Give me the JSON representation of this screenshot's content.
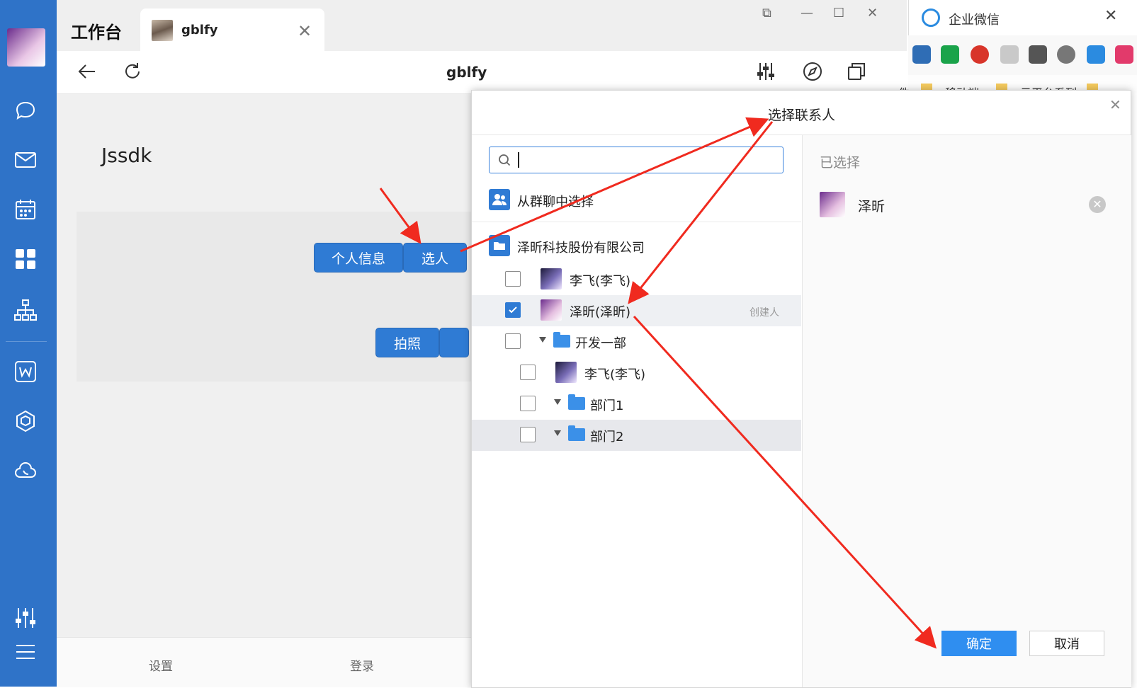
{
  "window": {
    "workbench_title": "工作台",
    "tab_label": "gblfy",
    "page_title": "gblfy"
  },
  "content": {
    "heading": "Jssdk",
    "buttons": {
      "personal_info": "个人信息",
      "select_people": "选人",
      "take_photo": "拍照"
    },
    "bottom_links": [
      "设置",
      "登录"
    ]
  },
  "wecom": {
    "title": "企业微信",
    "bookmarks": [
      "件",
      "移动端",
      "云平台系列"
    ]
  },
  "dialog": {
    "title": "选择联系人",
    "search_placeholder": "",
    "from_group_chat": "从群聊中选择",
    "company": "泽昕科技股份有限公司",
    "tree": [
      {
        "name": "李飞(李飞)",
        "type": "user",
        "checked": false,
        "level": 0
      },
      {
        "name": "泽昕(泽昕)",
        "type": "user",
        "checked": true,
        "level": 0,
        "badge": "创建人"
      },
      {
        "name": "开发一部",
        "type": "department",
        "checked": false,
        "level": 0
      },
      {
        "name": "李飞(李飞)",
        "type": "user",
        "checked": false,
        "level": 1
      },
      {
        "name": "部门1",
        "type": "department",
        "checked": false,
        "level": 1
      },
      {
        "name": "部门2",
        "type": "department",
        "checked": false,
        "level": 1
      }
    ],
    "selected_label": "已选择",
    "selected": [
      {
        "name": "泽昕"
      }
    ],
    "ok": "确定",
    "cancel": "取消"
  },
  "colors": {
    "sidebar": "#2f73c8",
    "primary": "#2f7bd4",
    "annotation_arrow": "#f02a1f"
  },
  "icons": [
    "chat-icon",
    "mail-icon",
    "calendar-icon",
    "workbench-icon",
    "org-chart-icon",
    "doc-icon",
    "cube-icon",
    "cloud-icon",
    "sliders-icon",
    "menu-icon",
    "back-icon",
    "refresh-icon",
    "compass-icon",
    "window-icon",
    "search-icon",
    "group-icon",
    "folder-icon",
    "check-icon",
    "remove-icon"
  ]
}
